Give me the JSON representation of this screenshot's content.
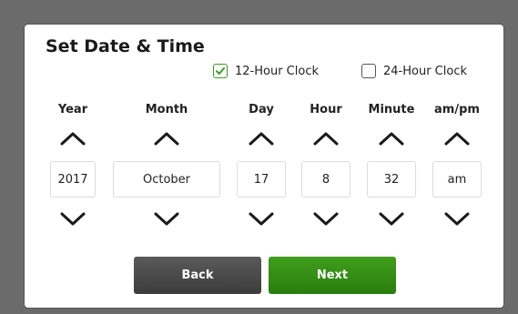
{
  "dialog": {
    "title": "Set Date & Time"
  },
  "clock_options": [
    {
      "label": "12-Hour Clock",
      "checked": true
    },
    {
      "label": "24-Hour Clock",
      "checked": false
    }
  ],
  "columns": [
    {
      "header": "Year",
      "value": "2017"
    },
    {
      "header": "Month",
      "value": "October"
    },
    {
      "header": "Day",
      "value": "17"
    },
    {
      "header": "Hour",
      "value": "8"
    },
    {
      "header": "Minute",
      "value": "32"
    },
    {
      "header": "am/pm",
      "value": "am"
    }
  ],
  "buttons": {
    "back_label": "Back",
    "next_label": "Next"
  },
  "colors": {
    "accent_green": "#3a9a1f",
    "back_button": "#4a4a4a",
    "backdrop": "#6b6b6b"
  },
  "icons": {
    "increment": "chevron-up-icon",
    "decrement": "chevron-down-icon",
    "check": "checkmark-icon"
  }
}
